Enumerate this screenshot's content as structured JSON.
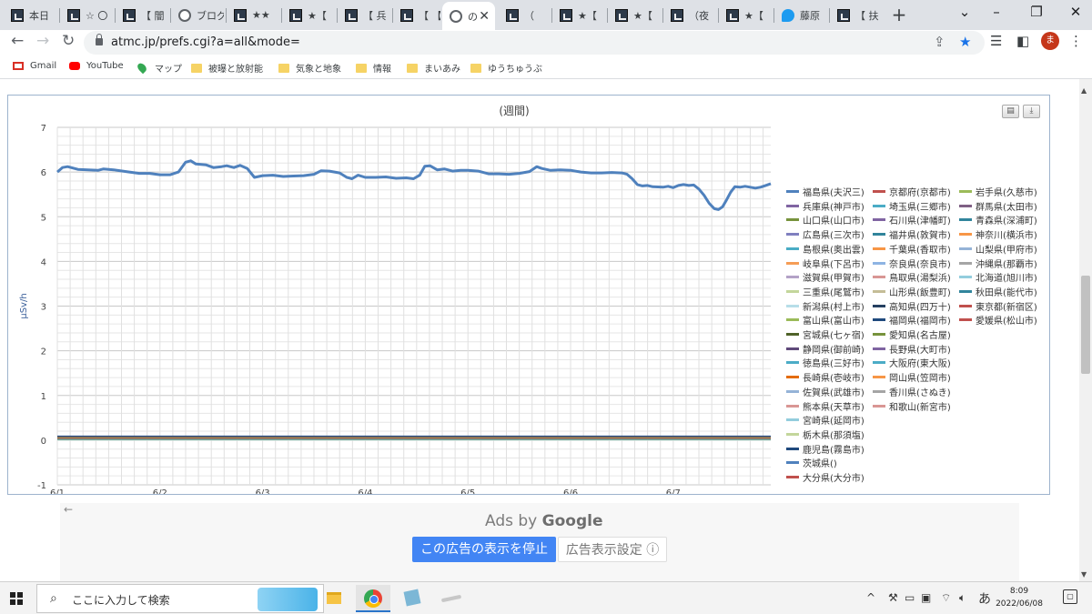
{
  "browser": {
    "tabs": [
      {
        "title": "本日",
        "icon": "site-icon"
      },
      {
        "title": "☆ 〇",
        "icon": "site-icon"
      },
      {
        "title": "【 闇",
        "icon": "site-icon"
      },
      {
        "title": "ブログ",
        "icon": "info-icon"
      },
      {
        "title": "★★",
        "icon": "site-icon"
      },
      {
        "title": "★【",
        "icon": "site-icon"
      },
      {
        "title": "【 兵",
        "icon": "site-icon"
      },
      {
        "title": "【 【",
        "icon": "site-icon"
      },
      {
        "title": "の",
        "icon": "globe-icon",
        "active": true
      },
      {
        "title": "（",
        "icon": "site-icon"
      },
      {
        "title": "★【",
        "icon": "site-icon"
      },
      {
        "title": "★【",
        "icon": "site-icon"
      },
      {
        "title": "（夜",
        "icon": "site-icon"
      },
      {
        "title": "★【",
        "icon": "site-icon"
      },
      {
        "title": "藤原",
        "icon": "twitter-icon"
      },
      {
        "title": "【 扶",
        "icon": "site-icon"
      }
    ],
    "new_tab": "+",
    "url": "atmc.jp/prefs.cgi?a=all&mode=",
    "avatar_initial": "ま",
    "bookmarks": [
      {
        "label": "Gmail",
        "icon": "gmail-icon"
      },
      {
        "label": "YouTube",
        "icon": "youtube-icon"
      },
      {
        "label": "マップ",
        "icon": "maps-icon"
      },
      {
        "label": "被曝と放射能",
        "icon": "folder-icon"
      },
      {
        "label": "気象と地象",
        "icon": "folder-icon"
      },
      {
        "label": "情報",
        "icon": "folder-icon"
      },
      {
        "label": "まいあみ",
        "icon": "folder-icon"
      },
      {
        "label": "ゆうちゅうぶ",
        "icon": "folder-icon"
      }
    ]
  },
  "chart_data": {
    "type": "line",
    "title": "(週間)",
    "ylabel": "μSv/h",
    "xlabel": "",
    "ylim": [
      -1,
      7
    ],
    "yticks": [
      -1,
      0,
      1,
      2,
      3,
      4,
      5,
      6,
      7
    ],
    "x_tick_labels": [
      "6/1",
      "6/2",
      "6/3",
      "6/4",
      "6/5",
      "6/6",
      "6/7"
    ],
    "xlim_days": [
      0,
      6.95
    ],
    "grid": true,
    "legend_position": "right",
    "main_series": {
      "name": "福島県(夫沢三)",
      "color": "#4f81bd",
      "points": [
        [
          0.0,
          6.0
        ],
        [
          0.05,
          6.1
        ],
        [
          0.1,
          6.12
        ],
        [
          0.2,
          6.06
        ],
        [
          0.3,
          6.05
        ],
        [
          0.4,
          6.04
        ],
        [
          0.45,
          6.07
        ],
        [
          0.55,
          6.05
        ],
        [
          0.7,
          6.0
        ],
        [
          0.8,
          5.97
        ],
        [
          0.9,
          5.97
        ],
        [
          1.0,
          5.94
        ],
        [
          1.1,
          5.94
        ],
        [
          1.18,
          6.0
        ],
        [
          1.25,
          6.22
        ],
        [
          1.3,
          6.25
        ],
        [
          1.35,
          6.18
        ],
        [
          1.45,
          6.16
        ],
        [
          1.52,
          6.1
        ],
        [
          1.6,
          6.12
        ],
        [
          1.65,
          6.14
        ],
        [
          1.72,
          6.1
        ],
        [
          1.78,
          6.15
        ],
        [
          1.85,
          6.08
        ],
        [
          1.92,
          5.88
        ],
        [
          2.0,
          5.92
        ],
        [
          2.1,
          5.93
        ],
        [
          2.2,
          5.9
        ],
        [
          2.3,
          5.91
        ],
        [
          2.4,
          5.92
        ],
        [
          2.5,
          5.95
        ],
        [
          2.57,
          6.03
        ],
        [
          2.65,
          6.02
        ],
        [
          2.75,
          5.98
        ],
        [
          2.82,
          5.88
        ],
        [
          2.87,
          5.85
        ],
        [
          2.93,
          5.93
        ],
        [
          3.0,
          5.88
        ],
        [
          3.1,
          5.88
        ],
        [
          3.2,
          5.89
        ],
        [
          3.3,
          5.86
        ],
        [
          3.4,
          5.87
        ],
        [
          3.47,
          5.85
        ],
        [
          3.53,
          5.93
        ],
        [
          3.58,
          6.13
        ],
        [
          3.63,
          6.14
        ],
        [
          3.7,
          6.05
        ],
        [
          3.77,
          6.07
        ],
        [
          3.85,
          6.02
        ],
        [
          3.93,
          6.04
        ],
        [
          4.0,
          6.04
        ],
        [
          4.1,
          6.02
        ],
        [
          4.2,
          5.96
        ],
        [
          4.3,
          5.96
        ],
        [
          4.4,
          5.95
        ],
        [
          4.5,
          5.97
        ],
        [
          4.6,
          6.01
        ],
        [
          4.67,
          6.12
        ],
        [
          4.72,
          6.08
        ],
        [
          4.8,
          6.04
        ],
        [
          4.9,
          6.05
        ],
        [
          5.0,
          6.04
        ],
        [
          5.1,
          6.0
        ],
        [
          5.2,
          5.98
        ],
        [
          5.3,
          5.98
        ],
        [
          5.4,
          5.99
        ],
        [
          5.5,
          5.98
        ],
        [
          5.55,
          5.95
        ],
        [
          5.6,
          5.85
        ],
        [
          5.65,
          5.72
        ],
        [
          5.7,
          5.69
        ],
        [
          5.75,
          5.7
        ],
        [
          5.8,
          5.67
        ],
        [
          5.9,
          5.66
        ],
        [
          5.95,
          5.68
        ],
        [
          6.0,
          5.65
        ],
        [
          6.05,
          5.7
        ],
        [
          6.1,
          5.72
        ],
        [
          6.15,
          5.7
        ],
        [
          6.2,
          5.71
        ],
        [
          6.25,
          5.62
        ],
        [
          6.3,
          5.48
        ],
        [
          6.35,
          5.3
        ],
        [
          6.4,
          5.18
        ],
        [
          6.44,
          5.16
        ],
        [
          6.48,
          5.22
        ],
        [
          6.52,
          5.38
        ],
        [
          6.56,
          5.55
        ],
        [
          6.6,
          5.67
        ],
        [
          6.65,
          5.66
        ],
        [
          6.7,
          5.68
        ],
        [
          6.75,
          5.66
        ],
        [
          6.8,
          5.64
        ],
        [
          6.85,
          5.66
        ],
        [
          6.9,
          5.7
        ],
        [
          6.95,
          5.74
        ]
      ]
    },
    "baseline_value": 0.05,
    "legend": [
      {
        "name": "福島県(夫沢三)",
        "color": "#4f81bd"
      },
      {
        "name": "京都府(京都市)",
        "color": "#c0504d"
      },
      {
        "name": "岩手県(久慈市)",
        "color": "#9bbb59"
      },
      {
        "name": "兵庫県(神戸市)",
        "color": "#8064a2"
      },
      {
        "name": "埼玉県(三郷市)",
        "color": "#4bacc6"
      },
      {
        "name": "群馬県(太田市)",
        "color": "#7f6084"
      },
      {
        "name": "山口県(山口市)",
        "color": "#77933c"
      },
      {
        "name": "石川県(津幡町)",
        "color": "#8064a2"
      },
      {
        "name": "青森県(深浦町)",
        "color": "#31859c"
      },
      {
        "name": "広島県(三次市)",
        "color": "#7f7fbf"
      },
      {
        "name": "福井県(敦賀市)",
        "color": "#31849b"
      },
      {
        "name": "神奈川(横浜市)",
        "color": "#f79646"
      },
      {
        "name": "島根県(奥出雲)",
        "color": "#4aacc5"
      },
      {
        "name": "千葉県(香取市)",
        "color": "#f79646"
      },
      {
        "name": "山梨県(甲府市)",
        "color": "#95b3d7"
      },
      {
        "name": "岐阜県(下呂市)",
        "color": "#f59d56"
      },
      {
        "name": "奈良県(奈良市)",
        "color": "#8eb4e3"
      },
      {
        "name": "沖縄県(那覇市)",
        "color": "#a5a5a5"
      },
      {
        "name": "滋賀県(甲賀市)",
        "color": "#b3a2c7"
      },
      {
        "name": "鳥取県(湯梨浜)",
        "color": "#d99694"
      },
      {
        "name": "北海道(旭川市)",
        "color": "#93cddd"
      },
      {
        "name": "三重県(尾鷲市)",
        "color": "#c3d69b"
      },
      {
        "name": "山形県(飯豊町)",
        "color": "#c4bd97"
      },
      {
        "name": "秋田県(能代市)",
        "color": "#31859c"
      },
      {
        "name": "新潟県(村上市)",
        "color": "#b7dee8"
      },
      {
        "name": "高知県(四万十)",
        "color": "#254061"
      },
      {
        "name": "東京都(新宿区)",
        "color": "#c0504d"
      },
      {
        "name": "富山県(富山市)",
        "color": "#9bbb59"
      },
      {
        "name": "福岡県(福岡市)",
        "color": "#1f497d"
      },
      {
        "name": "愛媛県(松山市)",
        "color": "#c0504d"
      },
      {
        "name": "宮城県(七ヶ宿)",
        "color": "#4f6228"
      },
      {
        "name": "愛知県(名古屋)",
        "color": "#77933c"
      },
      {
        "name": "静岡県(御前崎)",
        "color": "#5f497a"
      },
      {
        "name": "長野県(大町市)",
        "color": "#8064a2"
      },
      {
        "name": "徳島県(三好市)",
        "color": "#4bacc6"
      },
      {
        "name": "大阪府(東大阪)",
        "color": "#4bacc6"
      },
      {
        "name": "長崎県(壱岐市)",
        "color": "#e46c0a"
      },
      {
        "name": "岡山県(笠岡市)",
        "color": "#f79646"
      },
      {
        "name": "佐賀県(武雄市)",
        "color": "#95b3d7"
      },
      {
        "name": "香川県(さぬき)",
        "color": "#a5a5a5"
      },
      {
        "name": "熊本県(天草市)",
        "color": "#d99694"
      },
      {
        "name": "和歌山(新宮市)",
        "color": "#d99694"
      },
      {
        "name": "宮崎県(延岡市)",
        "color": "#93cddd"
      },
      {
        "name": "栃木県(那須塩)",
        "color": "#c3d69b"
      },
      {
        "name": "鹿児島(霧島市)",
        "color": "#1f497d"
      },
      {
        "name": "茨城県()",
        "color": "#4f81bd"
      },
      {
        "name": "大分県(大分市)",
        "color": "#c0504d"
      }
    ]
  },
  "ads": {
    "back_arrow": "←",
    "ads_by": "Ads by",
    "google": "Google",
    "stop_button": "この広告の表示を停止",
    "settings_button": "広告表示設定 ⓘ"
  },
  "taskbar": {
    "search_placeholder": "ここに入力して検索",
    "time": "8:09",
    "date": "2022/06/08",
    "ime": "あ"
  }
}
